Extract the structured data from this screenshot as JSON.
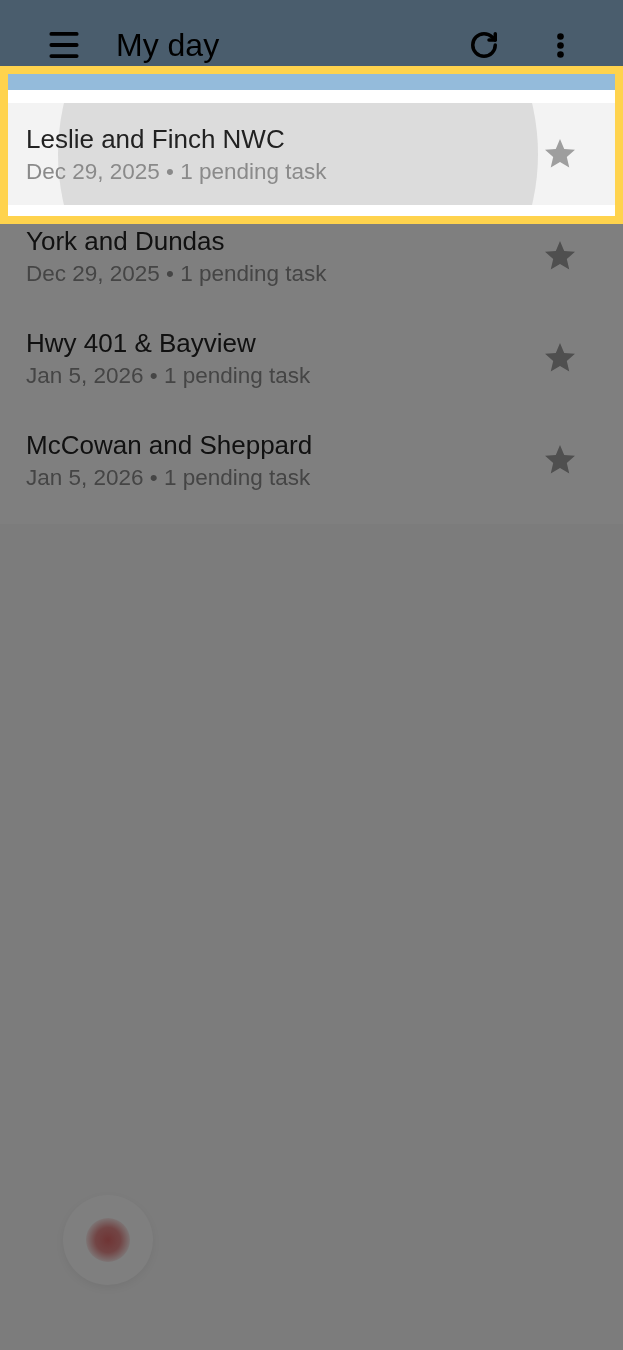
{
  "app_bar": {
    "title": "My day"
  },
  "tasks": [
    {
      "title": "Leslie and Finch NWC",
      "subtitle": "Dec 29, 2025 • 1 pending task",
      "selected": true,
      "starred": false
    },
    {
      "title": "York and Dundas",
      "subtitle": "Dec 29, 2025 • 1 pending task",
      "selected": false,
      "starred": false
    },
    {
      "title": "Hwy 401 & Bayview",
      "subtitle": "Jan 5, 2026 • 1 pending task",
      "selected": false,
      "starred": false
    },
    {
      "title": "McCowan and Sheppard",
      "subtitle": "Jan 5, 2026 • 1 pending task",
      "selected": false,
      "starred": false
    }
  ]
}
